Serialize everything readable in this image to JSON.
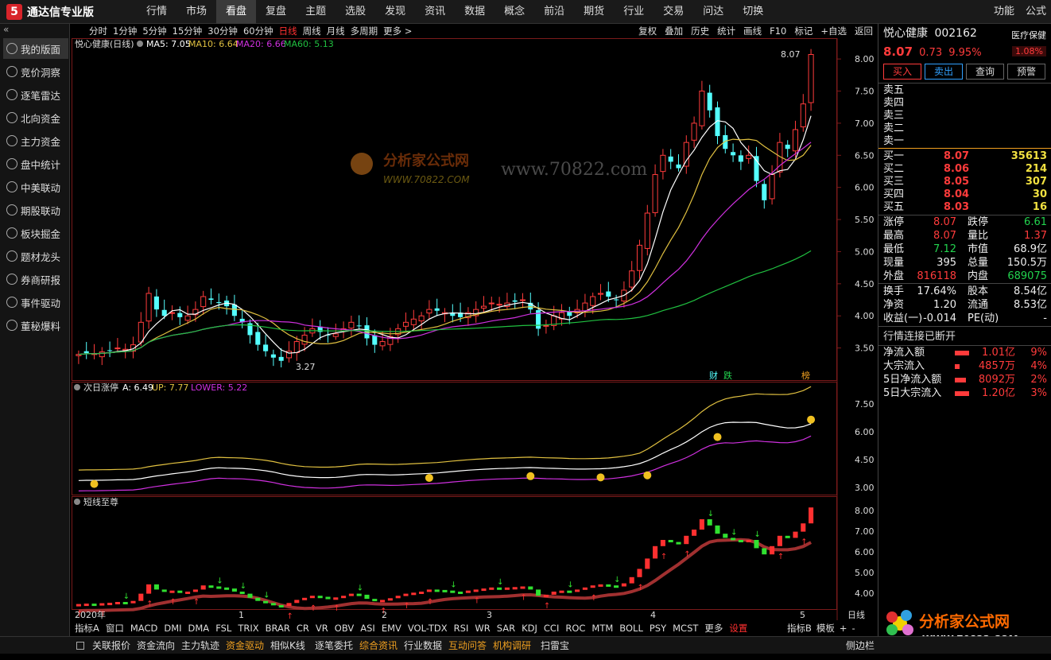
{
  "app": {
    "title": "通达信专业版",
    "logo_char": "5"
  },
  "menu": [
    "行情",
    "市场",
    "看盘",
    "复盘",
    "主题",
    "选股",
    "发现",
    "资讯",
    "数据",
    "概念",
    "前沿",
    "期货",
    "行业",
    "交易",
    "问达",
    "切换"
  ],
  "menu_right": [
    "功能",
    "公式"
  ],
  "sidebar": {
    "collapse": "«",
    "items": [
      "我的版面",
      "竞价洞察",
      "逐笔雷达",
      "北向资金",
      "主力资金",
      "盘中统计",
      "中美联动",
      "期股联动",
      "板块掘金",
      "题材龙头",
      "券商研报",
      "事件驱动",
      "董秘爆料"
    ]
  },
  "periods": [
    "分时",
    "1分钟",
    "5分钟",
    "15分钟",
    "30分钟",
    "60分钟",
    "日线",
    "周线",
    "月线",
    "多周期",
    "更多 >"
  ],
  "tools": [
    "复权",
    "叠加",
    "历史",
    "统计",
    "画线",
    "F10",
    "标记",
    "+自选",
    "返回"
  ],
  "main_legend": {
    "name": "悦心健康(日线)",
    "ma5": "MA5: 7.05",
    "ma10": "MA10: 6.64",
    "ma20": "MA20: 6.66",
    "ma60": "MA60: 5.13"
  },
  "ind1_legend": {
    "name": "次日涨停",
    "a": "A: 6.49",
    "up": "UP: 7.77",
    "lower": "LOWER: 5.22"
  },
  "ind2_legend": {
    "name": "短线至尊"
  },
  "annotations": {
    "high": "8.07",
    "low": "3.27",
    "tag1": "财",
    "tag2": "跌",
    "tag3": "榜"
  },
  "watermark": {
    "line1": "分析家公式网",
    "line2": "WWW.70822.COM",
    "url": "www.70822.com"
  },
  "axes": {
    "main": [
      "8.00",
      "7.50",
      "7.00",
      "6.50",
      "6.00",
      "5.50",
      "5.00",
      "4.50",
      "4.00",
      "3.50"
    ],
    "ind1": [
      "7.50",
      "6.00",
      "4.50",
      "3.00"
    ],
    "ind2": [
      "8.00",
      "7.00",
      "6.00",
      "5.00",
      "4.00"
    ],
    "time": [
      "2020年",
      "1",
      "2",
      "3",
      "4",
      "5"
    ],
    "time_label": "日线"
  },
  "colors": {
    "up": "#ff3b3b",
    "down": "#54ffff",
    "ma5": "#ffffff",
    "ma10": "#e0c040",
    "ma20": "#d030e0",
    "ma60": "#20c040"
  },
  "quote": {
    "name": "悦心健康",
    "code": "002162",
    "sector": "医疗保健",
    "price": "8.07",
    "change": "0.73",
    "pct": "9.95%",
    "turnover_pct": "1.08%",
    "buttons": [
      "买入",
      "卖出",
      "查询",
      "预警"
    ],
    "asks": [
      "卖五",
      "卖四",
      "卖三",
      "卖二",
      "卖一"
    ],
    "bids": [
      {
        "label": "买一",
        "price": "8.07",
        "vol": "35613"
      },
      {
        "label": "买二",
        "price": "8.06",
        "vol": "214"
      },
      {
        "label": "买三",
        "price": "8.05",
        "vol": "307"
      },
      {
        "label": "买四",
        "price": "8.04",
        "vol": "30"
      },
      {
        "label": "买五",
        "price": "8.03",
        "vol": "16"
      }
    ],
    "stats": [
      [
        "涨停",
        "8.07",
        "red",
        "跌停",
        "6.61",
        "green"
      ],
      [
        "最高",
        "8.07",
        "red",
        "量比",
        "1.37",
        "red"
      ],
      [
        "最低",
        "7.12",
        "green",
        "市值",
        "68.9亿",
        "white"
      ],
      [
        "现量",
        "395",
        "white",
        "总量",
        "150.5万",
        "white"
      ],
      [
        "外盘",
        "816118",
        "red",
        "内盘",
        "689075",
        "green"
      ]
    ],
    "stats2": [
      [
        "换手",
        "17.64%",
        "white",
        "股本",
        "8.54亿",
        "white"
      ],
      [
        "净资",
        "1.20",
        "white",
        "流通",
        "8.53亿",
        "white"
      ],
      [
        "收益(一)",
        "-0.014",
        "white",
        "PE(动)",
        "-",
        "white"
      ]
    ],
    "status": "行情连接已断开",
    "flows": [
      {
        "label": "净流入额",
        "value": "1.01亿",
        "pct": "9%"
      },
      {
        "label": "大宗流入",
        "value": "4857万",
        "pct": "4%"
      },
      {
        "label": "5日净流入额",
        "value": "8092万",
        "pct": "2%"
      },
      {
        "label": "5日大宗流入",
        "value": "1.20亿",
        "pct": "3%"
      }
    ]
  },
  "indicator_tabs": [
    "指标A",
    "窗口",
    "MACD",
    "DMI",
    "DMA",
    "FSL",
    "TRIX",
    "BRAR",
    "CR",
    "VR",
    "OBV",
    "ASI",
    "EMV",
    "VOL-TDX",
    "RSI",
    "WR",
    "SAR",
    "KDJ",
    "CCI",
    "ROC",
    "MTM",
    "BOLL",
    "PSY",
    "MCST",
    "更多",
    "设置"
  ],
  "indicator_right": [
    "指标B",
    "模板",
    "+",
    "-"
  ],
  "bottom_tabs": [
    "关联报价",
    "资金流向",
    "主力轨迹",
    "资金驱动",
    "相似K线",
    "逐笔委托",
    "综合资讯",
    "行业数据",
    "互动问答",
    "机构调研",
    "扫雷宝"
  ],
  "bottom_right": "侧边栏",
  "chart_data": {
    "type": "candlestick",
    "series_close": [
      3.4,
      3.42,
      3.41,
      3.44,
      3.46,
      3.5,
      3.48,
      3.55,
      3.9,
      4.35,
      4.1,
      4.0,
      4.05,
      3.98,
      4.0,
      4.1,
      4.3,
      4.25,
      4.2,
      4.15,
      4.0,
      3.9,
      3.7,
      3.55,
      3.45,
      3.35,
      3.3,
      3.45,
      3.6,
      3.7,
      3.8,
      3.75,
      3.7,
      3.72,
      3.8,
      3.9,
      3.85,
      3.65,
      3.55,
      3.6,
      3.68,
      3.8,
      3.9,
      3.95,
      4.0,
      4.1,
      4.08,
      4.05,
      4.0,
      3.98,
      4.05,
      4.1,
      4.15,
      4.2,
      4.18,
      4.2,
      4.22,
      4.25,
      4.1,
      3.8,
      3.85,
      4.0,
      4.05,
      4.0,
      4.1,
      4.2,
      4.3,
      4.35,
      4.3,
      4.25,
      4.4,
      4.7,
      5.1,
      5.6,
      6.2,
      6.5,
      6.4,
      6.3,
      6.7,
      7.0,
      7.5,
      7.2,
      6.8,
      6.6,
      6.5,
      6.4,
      6.5,
      6.1,
      5.8,
      6.2,
      6.7,
      6.6,
      6.9,
      7.3,
      8.07
    ]
  }
}
